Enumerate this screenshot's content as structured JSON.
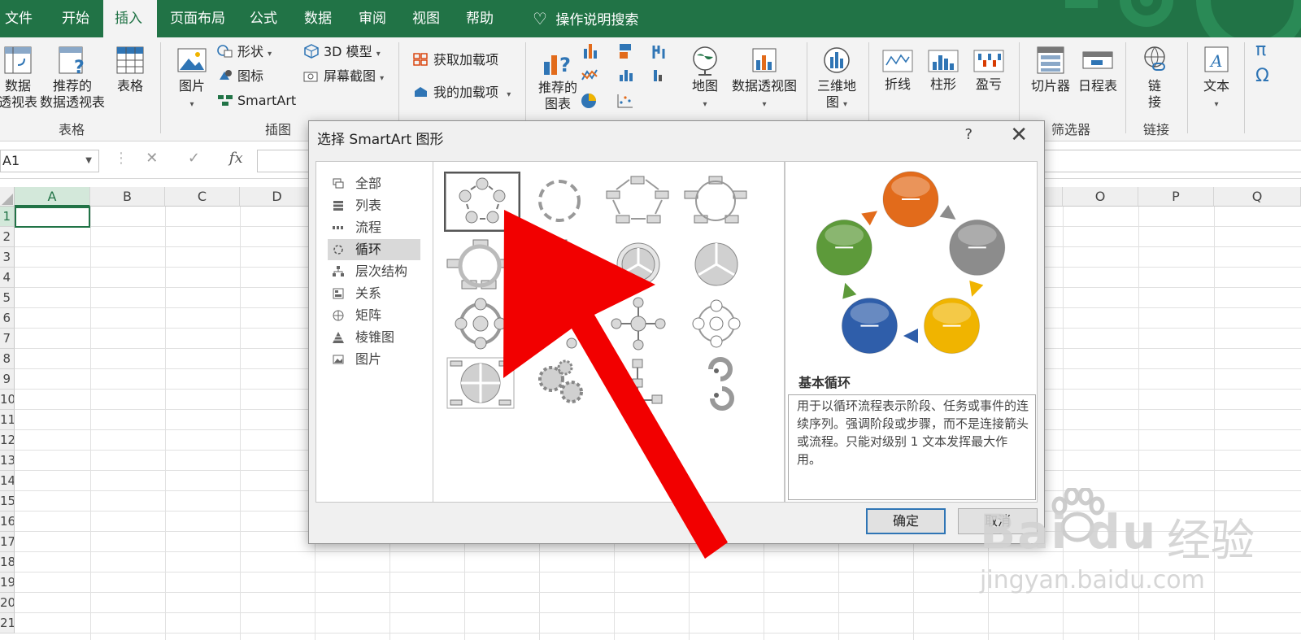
{
  "tabs": [
    "文件",
    "开始",
    "插入",
    "页面布局",
    "公式",
    "数据",
    "审阅",
    "视图",
    "帮助"
  ],
  "active_tab": "插入",
  "tell_me": "操作说明搜索",
  "ribbon": {
    "pivot_table": [
      "数据",
      "透视表"
    ],
    "recommended_pivot": [
      "推荐的",
      "数据透视表"
    ],
    "table": "表格",
    "group_tables": "表格",
    "pictures": "图片",
    "shapes": "形状",
    "icons": "图标",
    "smartart": "SmartArt",
    "model3d": "3D 模型",
    "screenshot": "屏幕截图",
    "group_illustrations": "插图",
    "get_addins": "获取加载项",
    "my_addins": "我的加载项",
    "recommended_charts": [
      "推荐的",
      "图表"
    ],
    "maps": "地图",
    "pivot_chart": "数据透视图",
    "map3d": [
      "三维地",
      "图"
    ],
    "spark_line": "折线",
    "spark_column": "柱形",
    "spark_winloss": "盈亏",
    "slicer": "切片器",
    "timeline": "日程表",
    "group_filters": "筛选器",
    "link": [
      "链",
      "接"
    ],
    "group_links": "链接",
    "text": "文本",
    "symbol_pi": "π",
    "symbol_omega": "Ω"
  },
  "formula_bar": {
    "name_box": "A1",
    "cancel": "✕",
    "enter": "✓",
    "fx": "fx",
    "formula": ""
  },
  "sheet": {
    "columns": [
      "A",
      "B",
      "C",
      "D",
      "O",
      "P",
      "Q"
    ],
    "rows": [
      "1",
      "2",
      "3",
      "4",
      "5",
      "6",
      "7",
      "8",
      "9",
      "10",
      "11",
      "12",
      "13",
      "14",
      "15",
      "16",
      "17",
      "18",
      "19",
      "20",
      "21"
    ],
    "active_cell": "A1"
  },
  "dialog": {
    "title": "选择 SmartArt 图形",
    "help": "?",
    "close": "✕",
    "categories": [
      "全部",
      "列表",
      "流程",
      "循环",
      "层次结构",
      "关系",
      "矩阵",
      "棱锥图",
      "图片"
    ],
    "selected_category": "循环",
    "preview_title": "基本循环",
    "preview_description": "用于以循环流程表示阶段、任务或事件的连续序列。强调阶段或步骤，而不是连接箭头或流程。只能对级别 1 文本发挥最大作用。",
    "ok": "确定",
    "cancel": "取消",
    "cycle_colors": [
      "#e26b1b",
      "#8c8c8c",
      "#f0b400",
      "#2f5eaa",
      "#5d9a3a"
    ]
  },
  "watermark": {
    "brand_latin": "Bai du",
    "brand_cn": "经验",
    "url": "jingyan.baidu.com"
  }
}
